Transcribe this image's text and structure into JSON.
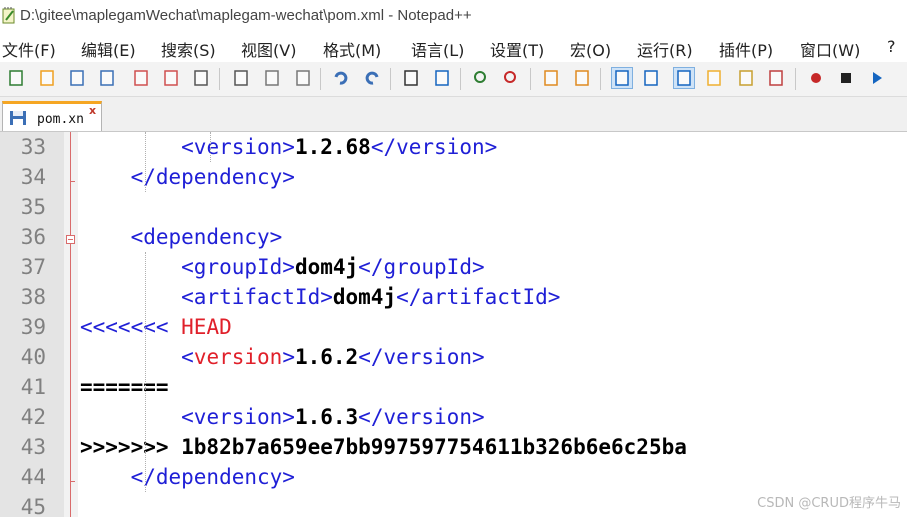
{
  "window": {
    "title": "D:\\gitee\\maplegamWechat\\maplegam-wechat\\pom.xml - Notepad++"
  },
  "menu": [
    {
      "label": "文件(F)"
    },
    {
      "label": "编辑(E)"
    },
    {
      "label": "搜索(S)"
    },
    {
      "label": "视图(V)"
    },
    {
      "label": "格式(M)"
    },
    {
      "label": "语言(L)"
    },
    {
      "label": "设置(T)"
    },
    {
      "label": "宏(O)"
    },
    {
      "label": "运行(R)"
    },
    {
      "label": "插件(P)"
    },
    {
      "label": "窗口(W)"
    },
    {
      "label": "?"
    }
  ],
  "toolbar": {
    "icons": [
      "new-file-icon",
      "open-file-icon",
      "save-icon",
      "save-all-icon",
      "close-icon",
      "close-all-icon",
      "print-icon",
      "cut-icon",
      "copy-icon",
      "paste-icon",
      "undo-icon",
      "redo-icon",
      "find-icon",
      "replace-icon",
      "zoom-in-icon",
      "zoom-out-icon",
      "sync-vertical-icon",
      "sync-horizontal-icon",
      "word-wrap-icon",
      "show-all-chars-icon",
      "indent-guide-icon",
      "doc-map-icon",
      "function-list-icon",
      "folder-workspace-icon",
      "record-macro-icon",
      "stop-macro-icon",
      "play-macro-icon"
    ]
  },
  "tabs": [
    {
      "label": "pom.xn",
      "close": "x"
    }
  ],
  "editor": {
    "lines": [
      {
        "n": "33",
        "segments": [
          {
            "t": "        "
          },
          {
            "t": "<version>",
            "c": "tag"
          },
          {
            "t": "1.2.68",
            "c": "txt"
          },
          {
            "t": "</version>",
            "c": "tag"
          }
        ]
      },
      {
        "n": "34",
        "segments": [
          {
            "t": "    "
          },
          {
            "t": "</dependency>",
            "c": "tag"
          }
        ]
      },
      {
        "n": "35",
        "segments": []
      },
      {
        "n": "36",
        "segments": [
          {
            "t": "    "
          },
          {
            "t": "<dependency>",
            "c": "tag"
          }
        ]
      },
      {
        "n": "37",
        "segments": [
          {
            "t": "        "
          },
          {
            "t": "<groupId>",
            "c": "tag"
          },
          {
            "t": "dom4j",
            "c": "txt"
          },
          {
            "t": "</groupId>",
            "c": "tag"
          }
        ]
      },
      {
        "n": "38",
        "segments": [
          {
            "t": "        "
          },
          {
            "t": "<artifactId>",
            "c": "tag"
          },
          {
            "t": "dom4j",
            "c": "txt"
          },
          {
            "t": "</artifactId>",
            "c": "tag"
          }
        ]
      },
      {
        "n": "39",
        "segments": [
          {
            "t": "<<<<<<< ",
            "c": "tag"
          },
          {
            "t": "HEAD",
            "c": "red"
          }
        ]
      },
      {
        "n": "40",
        "segments": [
          {
            "t": "        "
          },
          {
            "t": "<",
            "c": "tag"
          },
          {
            "t": "version",
            "c": "red"
          },
          {
            "t": ">",
            "c": "tag"
          },
          {
            "t": "1.6.2",
            "c": "txt"
          },
          {
            "t": "</version>",
            "c": "tag"
          }
        ]
      },
      {
        "n": "41",
        "segments": [
          {
            "t": "=======",
            "c": "txt"
          }
        ]
      },
      {
        "n": "42",
        "segments": [
          {
            "t": "        "
          },
          {
            "t": "<version>",
            "c": "tag"
          },
          {
            "t": "1.6.3",
            "c": "txt"
          },
          {
            "t": "</version>",
            "c": "tag"
          }
        ]
      },
      {
        "n": "43",
        "segments": [
          {
            "t": ">>>>>>> 1b82b7a659ee7bb997597754611b326b6e6c25ba",
            "c": "txt"
          }
        ]
      },
      {
        "n": "44",
        "segments": [
          {
            "t": "    "
          },
          {
            "t": "</dependency>",
            "c": "tag"
          }
        ]
      },
      {
        "n": "45",
        "segments": []
      }
    ]
  },
  "watermark": "CSDN @CRUD程序牛马"
}
